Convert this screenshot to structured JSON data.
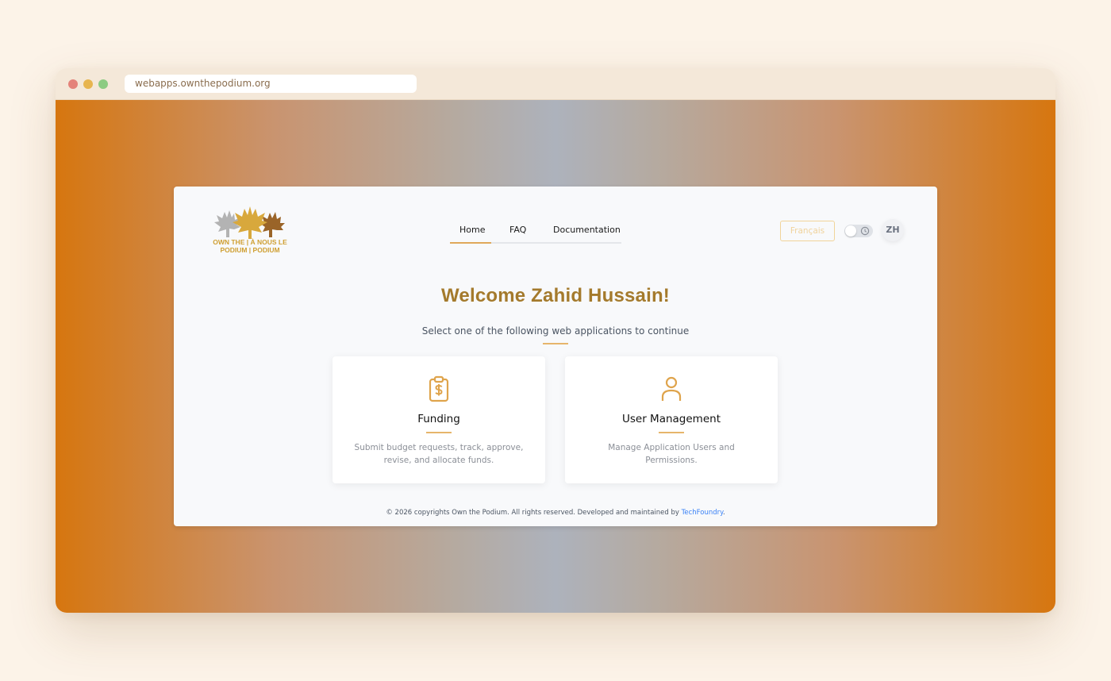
{
  "browser": {
    "url": "webapps.ownthepodium.org"
  },
  "logo": {
    "line1": "OWN THE | À NOUS LE",
    "line2": "PODIUM | PODIUM",
    "icon": "maple-leaves-logo"
  },
  "nav": {
    "items": [
      {
        "label": "Home",
        "active": true
      },
      {
        "label": "FAQ",
        "active": false
      },
      {
        "label": "Documentation",
        "active": false
      }
    ]
  },
  "header": {
    "language_button": "Français",
    "theme_toggle_icon": "moon-icon",
    "user_initials": "ZH"
  },
  "main": {
    "welcome": "Welcome Zahid Hussain!",
    "subtitle": "Select one of the following web applications to continue"
  },
  "apps": [
    {
      "title": "Funding",
      "description": "Submit budget requests, track, approve, revise, and allocate funds.",
      "icon": "clipboard-dollar-icon"
    },
    {
      "title": "User Management",
      "description": "Manage Application Users and Permissions.",
      "icon": "user-icon"
    }
  ],
  "footer": {
    "text": "© 2026 copyrights Own the Podium. All rights reserved. Developed and maintained by",
    "link": "TechFoundry",
    "end": "."
  },
  "colors": {
    "accent": "#a47a2c",
    "gold": "#e0a85a",
    "link": "#3b82f6"
  }
}
